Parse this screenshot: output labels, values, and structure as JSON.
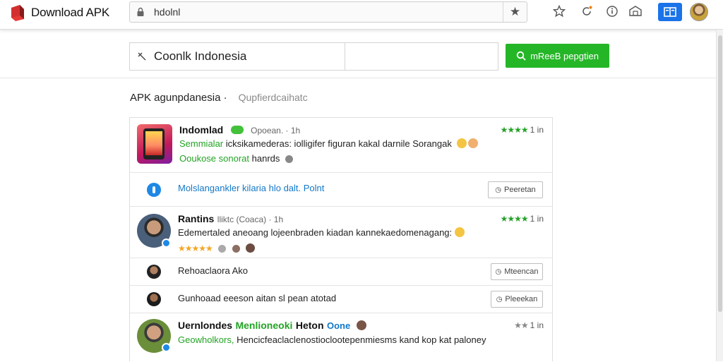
{
  "browser": {
    "brand_title": "Download APK",
    "url": "hdolnl",
    "colors": {
      "accent": "#1a73e8",
      "brand_red": "#e53935"
    },
    "toolbar_icons": [
      "star-outline-icon",
      "refresh-icon",
      "info-icon",
      "extensions-icon",
      "bookmarks-icon",
      "profile-avatar"
    ]
  },
  "search": {
    "value": "Coonlk Indonesia",
    "button_label": "mReeB pepgtien",
    "button_color": "#25b627"
  },
  "breadcrumb": {
    "main": "APK agunpdanesia ·",
    "sub": "Qupfierdcaihatc"
  },
  "list": {
    "item1": {
      "name": "Indomlad",
      "meta": "Opoean. · 1h",
      "rating_stars": "★★★★",
      "rating_num": "1 in",
      "line1": "Semmialar",
      "line1_rest": "icksikamederas: iolligifer figuran kakal darnile Sorangak",
      "line2_green": "Ooukose sonorat",
      "line2_rest": "hanrds"
    },
    "reply1": {
      "text": "Molslangankler kilaria hlo dalt. Polnt",
      "button": "Peeretan"
    },
    "item2": {
      "name": "Rantins",
      "meta": "lliktc (Coaca) · 1h",
      "rating_stars": "★★★★",
      "rating_num": "1 in",
      "line1": "Edemertaled aneoang lojeenbraden kiadan kannekaedomenagang:",
      "stars": "★★★★★"
    },
    "reply2": {
      "text": "Rehoaclaora Ako",
      "button": "Mteencan"
    },
    "reply3": {
      "text": "Gunhoaad eeeson aitan sl pean atotad",
      "button": "Pleeekan"
    },
    "item3": {
      "name": "Uernlondes",
      "name_green": "Menlioneoki",
      "name_tail": "Heton",
      "tag": "Oone",
      "rating_stars": "★★",
      "rating_num": "1 in",
      "line1_green": "Geowholkors,",
      "line1_rest": "Hencicfeaclaclenostioclootepenmiesms kand kop kat paloney"
    }
  }
}
